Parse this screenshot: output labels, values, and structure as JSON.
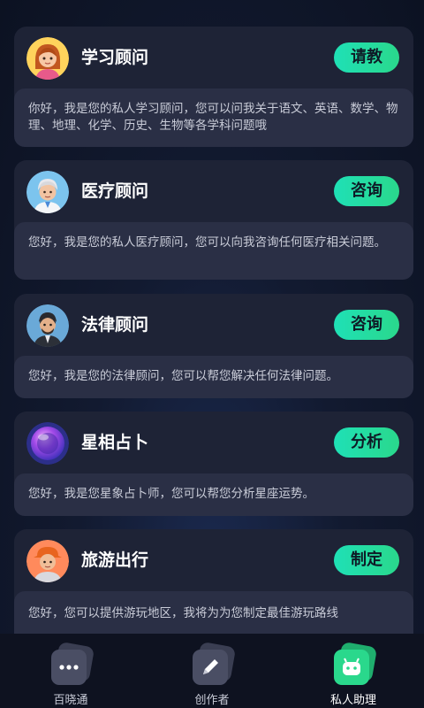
{
  "cards": [
    {
      "title": "学习顾问",
      "action": "请教",
      "avatar_icon": "girl-avatar-icon",
      "description": "你好，我是您的私人学习顾问，您可以问我关于语文、英语、数学、物理、地理、化学、历史、生物等各学科问题哦"
    },
    {
      "title": "医疗顾问",
      "action": "咨询",
      "avatar_icon": "doctor-avatar-icon",
      "description": "您好，我是您的私人医疗顾问，您可以向我咨询任何医疗相关问题。"
    },
    {
      "title": "法律顾问",
      "action": "咨询",
      "avatar_icon": "lawyer-avatar-icon",
      "description": "您好，我是您的法律顾问，您可以帮您解决任何法律问题。"
    },
    {
      "title": "星相占卜",
      "action": "分析",
      "avatar_icon": "crystal-ball-icon",
      "description": "您好，我是您星象占卜师，您可以帮您分析星座运势。"
    },
    {
      "title": "旅游出行",
      "action": "制定",
      "avatar_icon": "traveler-avatar-icon",
      "description": "您好，您可以提供游玩地区，我将为为您制定最佳游玩路线"
    }
  ],
  "tabbar": {
    "tabs": [
      {
        "label": "百晓通",
        "icon": "chat-bubble-icon",
        "active": false
      },
      {
        "label": "创作者",
        "icon": "pencil-icon",
        "active": false
      },
      {
        "label": "私人助理",
        "icon": "robot-icon",
        "active": true
      }
    ]
  },
  "colors": {
    "accent": "#1fe0b6",
    "card_bg": "#1e2336",
    "desc_bg": "#2a2f45",
    "tabbar_bg": "#0e1220"
  }
}
